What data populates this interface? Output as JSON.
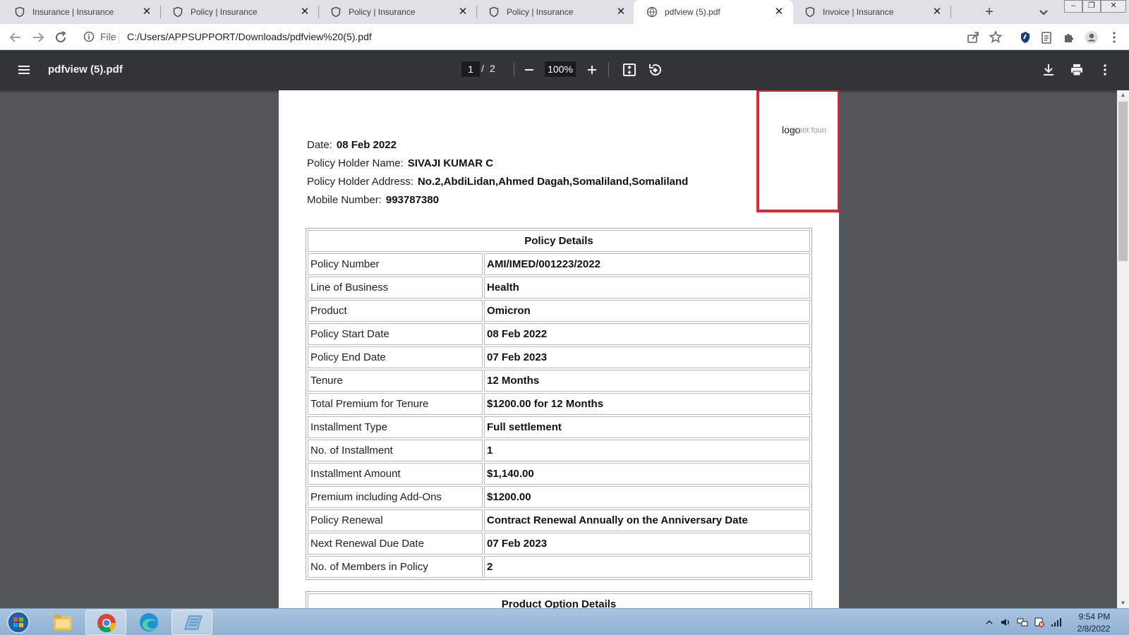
{
  "tabs": [
    {
      "title": "Insurance | Insurance",
      "favicon": "shield-icon",
      "active": false
    },
    {
      "title": "Policy | Insurance",
      "favicon": "shield-icon",
      "active": false
    },
    {
      "title": "Policy | Insurance",
      "favicon": "shield-icon",
      "active": false
    },
    {
      "title": "Policy | Insurance",
      "favicon": "shield-icon",
      "active": false
    },
    {
      "title": "pdfview (5).pdf",
      "favicon": "globe-icon",
      "active": true
    },
    {
      "title": "Invoice | Insurance",
      "favicon": "shield-icon",
      "active": false
    }
  ],
  "tab_close_glyph": "✕",
  "new_tab_glyph": "+",
  "address": {
    "scheme_label": "File",
    "url": "C:/Users/APPSUPPORT/Downloads/pdfview%20(5).pdf"
  },
  "pdf_viewer": {
    "title": "pdfview (5).pdf",
    "current_page": "1",
    "page_separator": "/",
    "total_pages": "2",
    "zoom": "100%"
  },
  "document": {
    "logo_text": "logo",
    "logo_alt_fragment": "e not foun",
    "header": [
      {
        "label": "Date:",
        "value": "08 Feb 2022"
      },
      {
        "label": "Policy Holder Name:",
        "value": "SIVAJI KUMAR C"
      },
      {
        "label": "Policy Holder Address:",
        "value": "No.2,AbdiLidan,Ahmed Dagah,Somaliland,Somaliland"
      },
      {
        "label": "Mobile Number:",
        "value": "993787380"
      }
    ],
    "policy_table_title": "Policy Details",
    "policy_rows": [
      {
        "label": "Policy Number",
        "value": "AMI/IMED/001223/2022"
      },
      {
        "label": "Line of Business",
        "value": "Health"
      },
      {
        "label": "Product",
        "value": "Omicron"
      },
      {
        "label": "Policy Start Date",
        "value": "08 Feb 2022"
      },
      {
        "label": "Policy End Date",
        "value": "07 Feb 2023"
      },
      {
        "label": "Tenure",
        "value": "12 Months"
      },
      {
        "label": "Total Premium for Tenure",
        "value": "$1200.00 for 12 Months"
      },
      {
        "label": "Installment Type",
        "value": "Full settlement"
      },
      {
        "label": "No. of Installment",
        "value": "1"
      },
      {
        "label": "Installment Amount",
        "value": "$1,140.00"
      },
      {
        "label": "Premium including Add-Ons",
        "value": "$1200.00"
      },
      {
        "label": "Policy Renewal",
        "value": "Contract Renewal Annually on the Anniversary Date"
      },
      {
        "label": "Next Renewal Due Date",
        "value": "07 Feb 2023"
      },
      {
        "label": "No. of Members in Policy",
        "value": "2"
      }
    ],
    "next_table_title": "Product Option Details"
  },
  "taskbar": {
    "time": "9:54 PM",
    "date": "2/8/2022"
  },
  "colors": {
    "tabstrip": "#dee1e6",
    "pdf_toolbar": "#323639",
    "viewer_bg": "#525659",
    "logo_frame": "#e3262f",
    "taskbar": "#a9c4e0"
  }
}
